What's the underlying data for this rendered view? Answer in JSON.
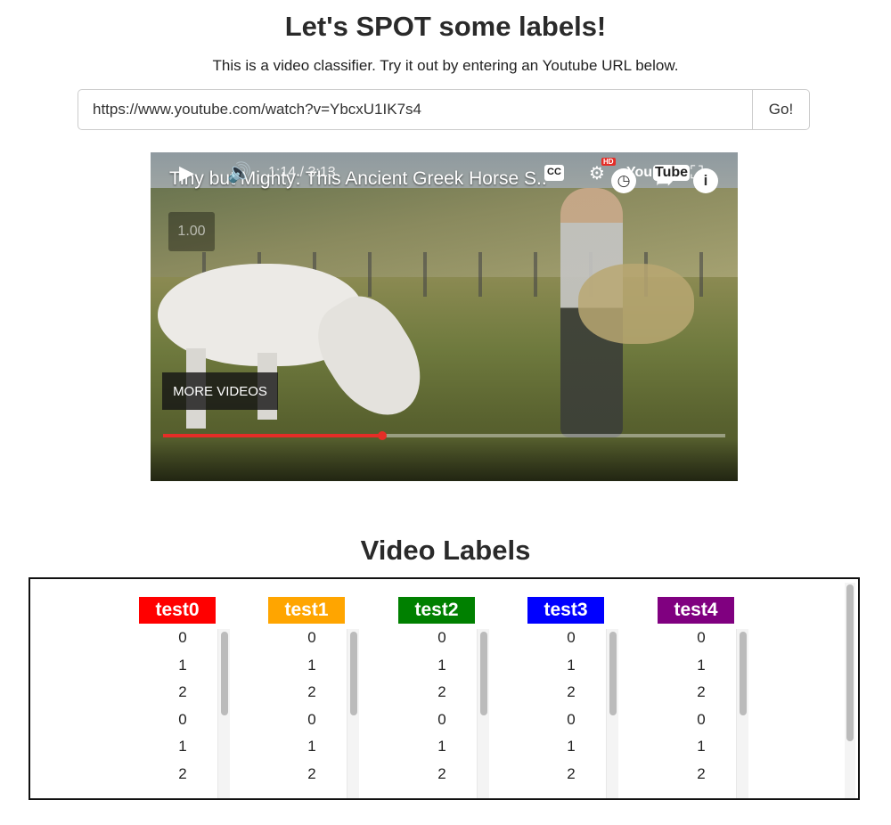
{
  "page": {
    "title": "Let's SPOT some labels!",
    "subtitle": "This is a video classifier. Try it out by entering an Youtube URL below."
  },
  "url_form": {
    "value": "https://www.youtube.com/watch?v=YbcxU1IK7s4",
    "go_label": "Go!"
  },
  "player": {
    "video_title": "Tiny but Mighty: This Ancient Greek Horse S..",
    "speed_label": "1.00",
    "more_videos_label": "MORE VIDEOS",
    "time_display": "1:14 / 3:13",
    "progress_fraction": 0.39,
    "icons": {
      "watch_later": "clock-icon",
      "share": "share-arrow-icon",
      "info": "info-icon",
      "play": "play-icon",
      "volume": "volume-icon",
      "captions": "cc-icon",
      "settings": "settings-hd-icon",
      "youtube": "youtube-logo",
      "fullscreen": "fullscreen-icon"
    },
    "cc_text": "CC",
    "hd_text": "HD",
    "logo_text_a": "You",
    "logo_text_b": "Tube"
  },
  "labels_section": {
    "title": "Video Labels",
    "columns": [
      {
        "name": "test0",
        "color": "#ff0000",
        "values": [
          "0",
          "1",
          "2",
          "0",
          "1",
          "2"
        ]
      },
      {
        "name": "test1",
        "color": "#ffa500",
        "values": [
          "0",
          "1",
          "2",
          "0",
          "1",
          "2"
        ]
      },
      {
        "name": "test2",
        "color": "#008000",
        "values": [
          "0",
          "1",
          "2",
          "0",
          "1",
          "2"
        ]
      },
      {
        "name": "test3",
        "color": "#0000ff",
        "values": [
          "0",
          "1",
          "2",
          "0",
          "1",
          "2"
        ]
      },
      {
        "name": "test4",
        "color": "#800080",
        "values": [
          "0",
          "1",
          "2",
          "0",
          "1",
          "2"
        ]
      }
    ]
  }
}
